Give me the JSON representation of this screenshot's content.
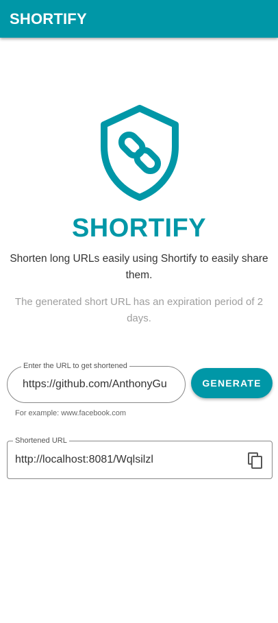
{
  "app_bar": {
    "title": "SHORTIFY"
  },
  "hero": {
    "logo_icon": "shield-link-icon",
    "brand": "SHORTIFY",
    "description": "Shorten long URLs easily using Shortify to easily share them.",
    "note": "The generated short URL has an expiration period of 2 days."
  },
  "url_input": {
    "label": "Enter the URL to get shortened",
    "value": "https://github.com/AnthonyGu",
    "helper": "For example: www.facebook.com"
  },
  "generate_button": {
    "label": "GENERATE"
  },
  "short_url": {
    "label": "Shortened URL",
    "value": "http://localhost:8081/Wqlsilzl",
    "copy_icon": "copy-icon"
  },
  "colors": {
    "accent": "#0097a7",
    "text": "#333333",
    "muted": "#9e9e9e"
  }
}
